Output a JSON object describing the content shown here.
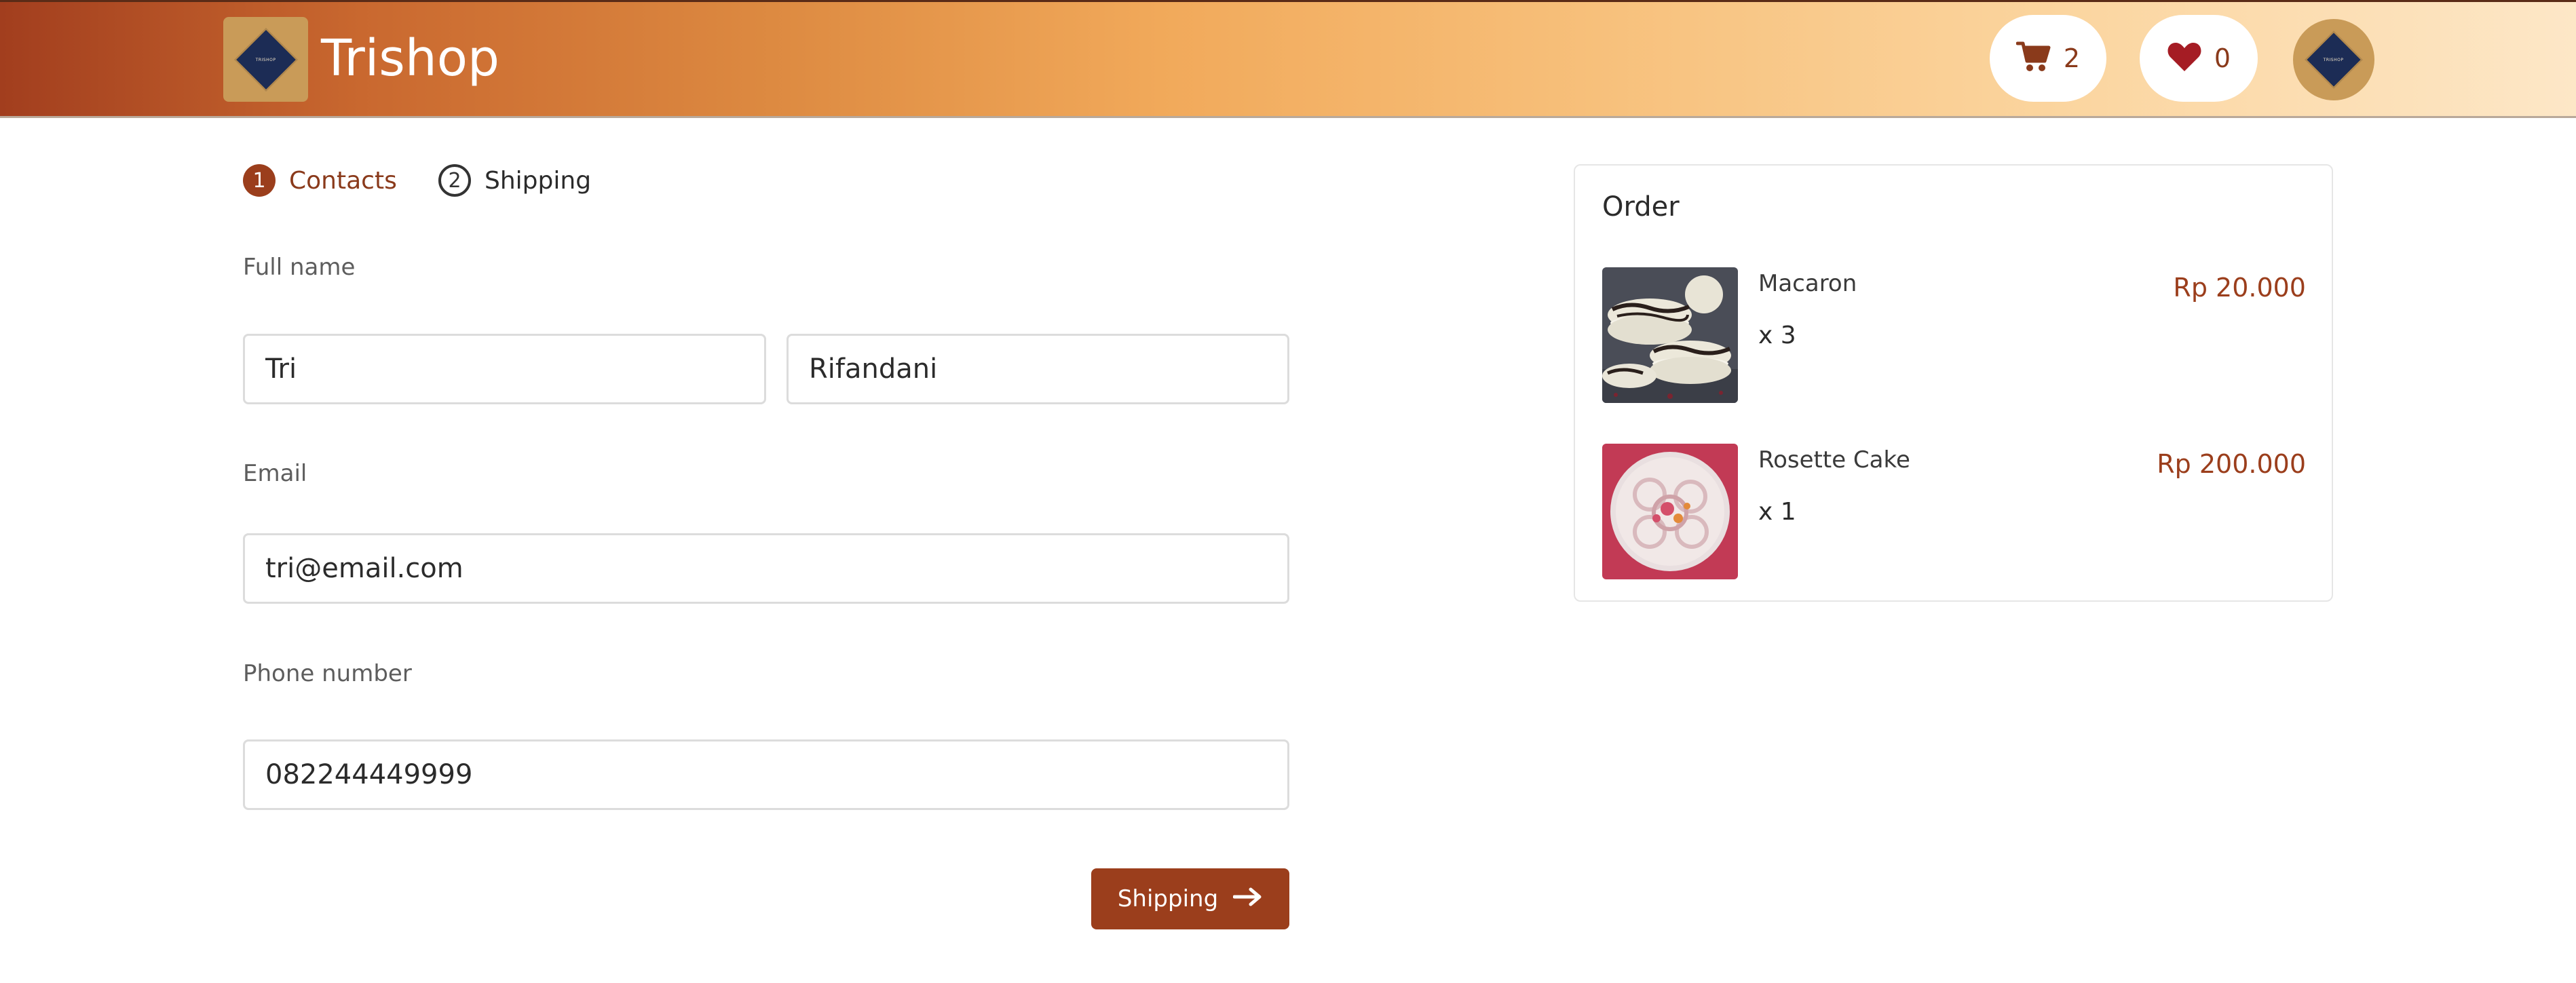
{
  "header": {
    "brand": "Trishop",
    "logo_text": "TRISHOP",
    "cart_count": "2",
    "wishlist_count": "0",
    "avatar_text": "TRISHOP"
  },
  "stepper": {
    "steps": [
      {
        "number": "1",
        "label": "Contacts",
        "active": true
      },
      {
        "number": "2",
        "label": "Shipping",
        "active": false
      }
    ]
  },
  "form": {
    "full_name_label": "Full name",
    "first_name": "Tri",
    "last_name": "Rifandani",
    "email_label": "Email",
    "email": "tri@email.com",
    "phone_label": "Phone number",
    "phone": "082244449999",
    "next_button_label": "Shipping"
  },
  "order": {
    "title": "Order",
    "items": [
      {
        "name": "Macaron",
        "quantity": "x 3",
        "price": "Rp 20.000"
      },
      {
        "name": "Rosette Cake",
        "quantity": "x 1",
        "price": "Rp 200.000"
      }
    ]
  },
  "colors": {
    "accent": "#9b3e1c",
    "header_start": "#a23e1e",
    "header_end": "#fde7c7",
    "logo_tile": "#c99b58",
    "logo_diamond": "#1c2c55"
  },
  "icons": {
    "cart": "shopping-cart-icon",
    "wishlist": "heart-icon",
    "next": "arrow-right-icon"
  }
}
